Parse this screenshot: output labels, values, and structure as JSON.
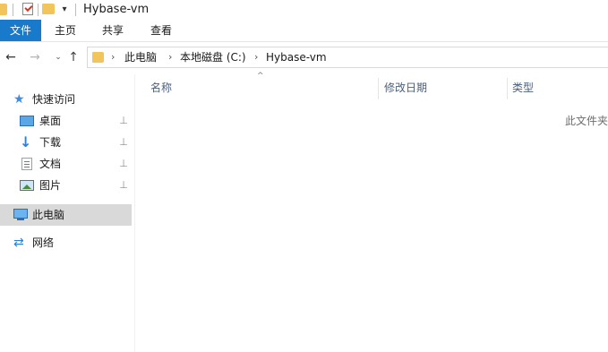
{
  "window": {
    "title": "Hybase-vm"
  },
  "quick_access_toolbar": {
    "icons": [
      "folder-icon",
      "properties-check-icon",
      "new-folder-icon",
      "customize-dropdown-icon"
    ],
    "dropdown_glyph": "▾"
  },
  "ribbon": {
    "tabs": [
      {
        "label": "文件",
        "active": true
      },
      {
        "label": "主页"
      },
      {
        "label": "共享"
      },
      {
        "label": "查看"
      }
    ],
    "accent": "#1979ca"
  },
  "navigation": {
    "back_glyph": "←",
    "forward_glyph": "→",
    "recent_glyph": "⌄",
    "up_glyph": "↑"
  },
  "address_bar": {
    "separator": "›",
    "breadcrumbs": [
      "此电脑",
      "本地磁盘 (C:)",
      "Hybase-vm"
    ]
  },
  "nav_pane": {
    "quick_access": {
      "label": "快速访问",
      "icon": "star-icon"
    },
    "pinned": [
      {
        "label": "桌面",
        "icon": "desktop-icon"
      },
      {
        "label": "下载",
        "icon": "download-icon"
      },
      {
        "label": "文档",
        "icon": "document-icon"
      },
      {
        "label": "图片",
        "icon": "pictures-icon"
      }
    ],
    "pin_glyph": "📌",
    "this_pc": {
      "label": "此电脑",
      "icon": "computer-icon",
      "selected": true
    },
    "network": {
      "label": "网络",
      "icon": "network-icon"
    }
  },
  "file_list": {
    "sort_glyph": "^",
    "columns": [
      "名称",
      "修改日期",
      "类型"
    ],
    "empty_message": "此文件夹"
  },
  "colors": {
    "folder": "#f2c55c",
    "selection": "#d9d9d9",
    "header_text": "#4c607a"
  }
}
